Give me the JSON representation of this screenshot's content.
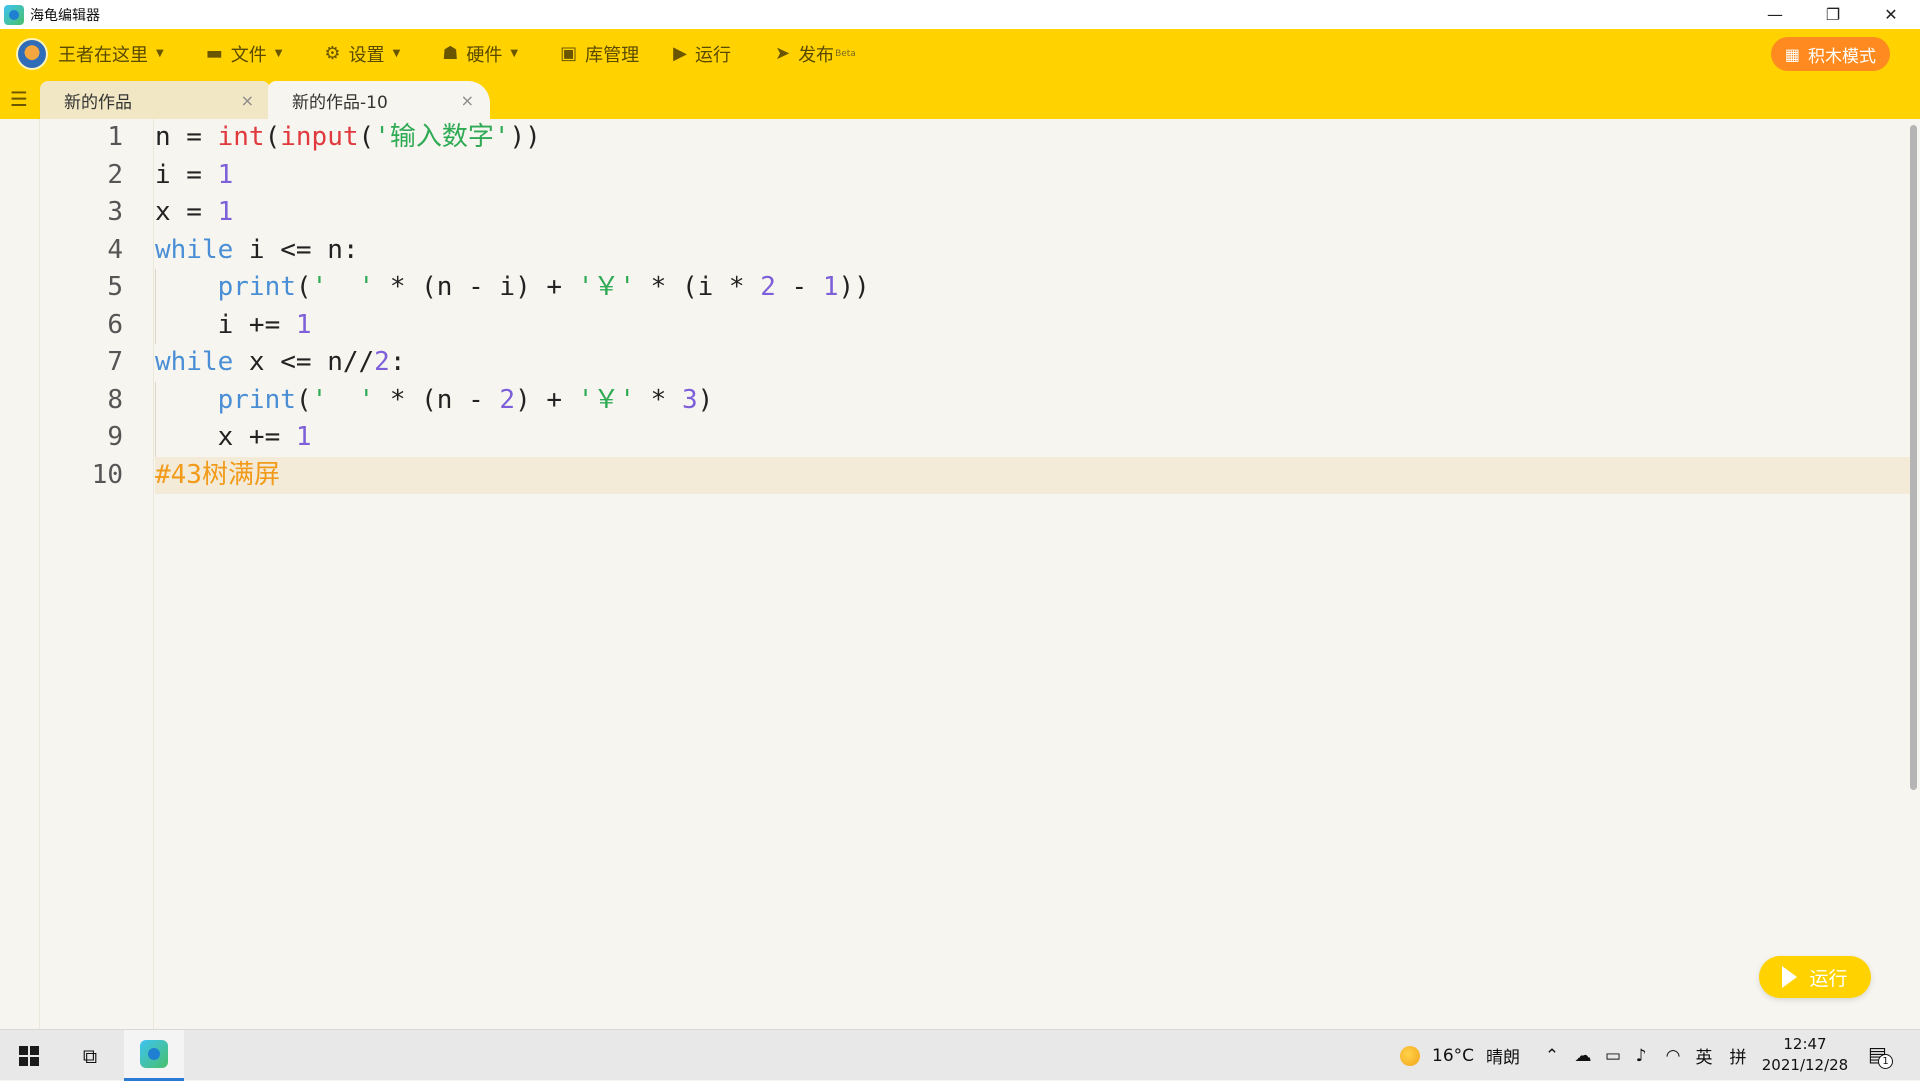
{
  "window": {
    "title": "海龟编辑器",
    "controls": {
      "minimize": "—",
      "restore": "❐",
      "close": "✕"
    }
  },
  "toolbar": {
    "user": {
      "label": "王者在这里",
      "icon": "avatar-icon"
    },
    "file": {
      "label": "文件",
      "icon": "folder-icon"
    },
    "settings": {
      "label": "设置",
      "icon": "gear-icon"
    },
    "hardware": {
      "label": "硬件",
      "icon": "robot-icon"
    },
    "library": {
      "label": "库管理",
      "icon": "box-icon"
    },
    "run": {
      "label": "运行",
      "icon": "play-circle-icon"
    },
    "publish": {
      "label": "发布",
      "beta": "Beta",
      "icon": "paper-plane-icon"
    },
    "blocks_mode": {
      "label": "积木模式",
      "icon": "blocks-icon"
    },
    "accent_color": "#ffd200"
  },
  "tabs": [
    {
      "label": "新的作品",
      "active": false,
      "close": "×"
    },
    {
      "label": "新的作品-10",
      "active": true,
      "close": "×"
    }
  ],
  "editor": {
    "line_numbers": [
      "1",
      "2",
      "3",
      "4",
      "5",
      "6",
      "7",
      "8",
      "9",
      "10"
    ],
    "lines": [
      [
        {
          "t": "n = "
        },
        {
          "t": "int",
          "c": "fn"
        },
        {
          "t": "("
        },
        {
          "t": "input",
          "c": "fn"
        },
        {
          "t": "("
        },
        {
          "t": "'输入数字'",
          "c": "str"
        },
        {
          "t": "))"
        }
      ],
      [
        {
          "t": "i = "
        },
        {
          "t": "1",
          "c": "num"
        }
      ],
      [
        {
          "t": "x = "
        },
        {
          "t": "1",
          "c": "num"
        }
      ],
      [
        {
          "t": "while",
          "c": "kw"
        },
        {
          "t": " i <= n:"
        }
      ],
      [
        {
          "t": "    "
        },
        {
          "t": "print",
          "c": "bi"
        },
        {
          "t": "("
        },
        {
          "t": "'  '",
          "c": "str"
        },
        {
          "t": " * (n - i) + "
        },
        {
          "t": "'￥'",
          "c": "str"
        },
        {
          "t": " * (i * "
        },
        {
          "t": "2",
          "c": "num"
        },
        {
          "t": " - "
        },
        {
          "t": "1",
          "c": "num"
        },
        {
          "t": "))"
        }
      ],
      [
        {
          "t": "    i += "
        },
        {
          "t": "1",
          "c": "num"
        }
      ],
      [
        {
          "t": "while",
          "c": "kw"
        },
        {
          "t": " x <= n//"
        },
        {
          "t": "2",
          "c": "num"
        },
        {
          "t": ":"
        }
      ],
      [
        {
          "t": "    "
        },
        {
          "t": "print",
          "c": "bi"
        },
        {
          "t": "("
        },
        {
          "t": "'  '",
          "c": "str"
        },
        {
          "t": " * (n - "
        },
        {
          "t": "2",
          "c": "num"
        },
        {
          "t": ") + "
        },
        {
          "t": "'￥'",
          "c": "str"
        },
        {
          "t": " * "
        },
        {
          "t": "3",
          "c": "num"
        },
        {
          "t": ")"
        }
      ],
      [
        {
          "t": "    x += "
        },
        {
          "t": "1",
          "c": "num"
        }
      ],
      [
        {
          "t": "#43树满屏",
          "c": "cmt"
        }
      ]
    ],
    "active_line": 10,
    "run_button": "运行",
    "colors": {
      "keyword": "#4a8fd6",
      "function": "#e0393e",
      "string": "#2faa55",
      "number": "#7c5fd9",
      "comment": "#f29a1a"
    }
  },
  "taskbar": {
    "weather": {
      "temp": "16°C",
      "condition": "晴朗",
      "icon": "sun-icon"
    },
    "tray_icons": [
      "chevron-up-icon",
      "cloud-icon",
      "battery-icon",
      "volume-icon",
      "wifi-icon"
    ],
    "ime_lang": "英",
    "ime_mode": "拼",
    "time": "12:47",
    "date": "2021/12/28",
    "notifications": "1"
  }
}
